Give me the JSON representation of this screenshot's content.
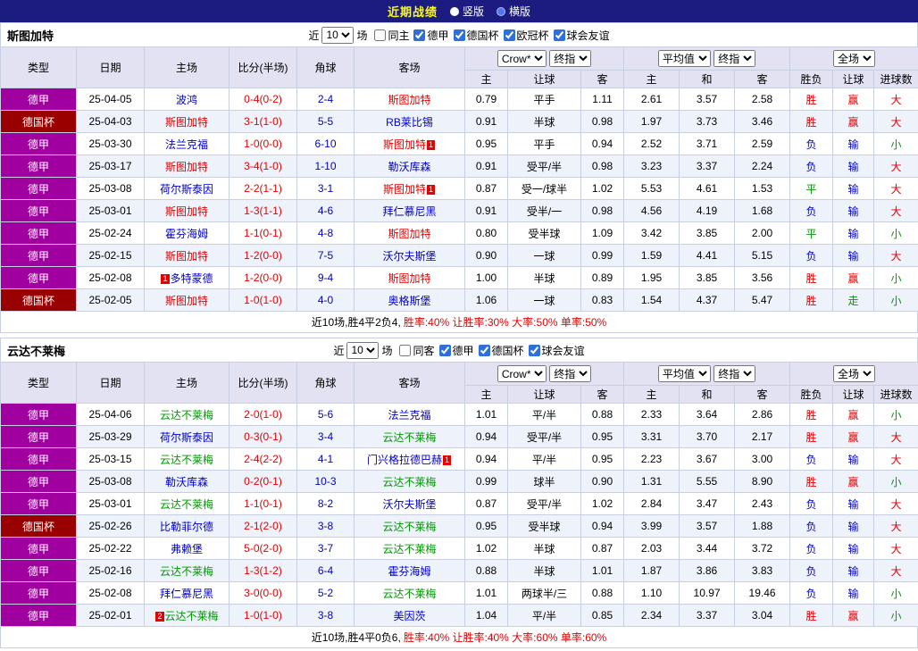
{
  "topbar": {
    "title": "近期战绩",
    "radios": [
      {
        "label": "竖版",
        "checked": true
      },
      {
        "label": "横版",
        "checked": false
      }
    ]
  },
  "columns": {
    "type": "类型",
    "date": "日期",
    "home": "主场",
    "score": "比分(半场)",
    "corner": "角球",
    "away": "客场",
    "h": "主",
    "handicap": "让球",
    "a": "客",
    "draw": "和",
    "result": "胜负",
    "goals": "进球数"
  },
  "selects": {
    "company": "Crow*",
    "final": "终指",
    "average": "平均值",
    "fulltime": "全场"
  },
  "league_colors": {
    "德甲": "#a000a0",
    "德国杯": "#990000"
  },
  "opponent_color": "#0000cc",
  "value_colors": {
    "胜": "#e60000",
    "负": "#0000cc",
    "平": "#009900",
    "赢": "#e60000",
    "输": "#0000cc",
    "走": "#009900",
    "大": "#e60000",
    "小": "#009900"
  },
  "tables": [
    {
      "team": "斯图加特",
      "team_color": "#e60000",
      "filter": {
        "near": "近",
        "count": "10",
        "games": "场",
        "checkboxes": [
          {
            "label": "同主",
            "checked": false
          },
          {
            "label": "德甲",
            "checked": true
          },
          {
            "label": "德国杯",
            "checked": true
          },
          {
            "label": "欧冠杯",
            "checked": true
          },
          {
            "label": "球会友谊",
            "checked": true
          }
        ]
      },
      "rows": [
        {
          "lg": "德甲",
          "dt": "25-04-05",
          "h": "波鸿",
          "hc": "",
          "s": "0-4(0-2)",
          "cn": "2-4",
          "a": "斯图加特",
          "ac": "",
          "o1": "0.79",
          "hd": "平手",
          "o2": "1.11",
          "m1": "2.61",
          "m2": "3.57",
          "m3": "2.58",
          "r1": "胜",
          "r2": "赢",
          "r3": "大"
        },
        {
          "lg": "德国杯",
          "dt": "25-04-03",
          "h": "斯图加特",
          "hc": "",
          "s": "3-1(1-0)",
          "cn": "5-5",
          "a": "RB莱比锡",
          "ac": "",
          "o1": "0.91",
          "hd": "半球",
          "o2": "0.98",
          "m1": "1.97",
          "m2": "3.73",
          "m3": "3.46",
          "r1": "胜",
          "r2": "赢",
          "r3": "大"
        },
        {
          "lg": "德甲",
          "dt": "25-03-30",
          "h": "法兰克福",
          "hc": "",
          "s": "1-0(0-0)",
          "cn": "6-10",
          "a": "斯图加特",
          "ac": "1",
          "o1": "0.95",
          "hd": "平手",
          "o2": "0.94",
          "m1": "2.52",
          "m2": "3.71",
          "m3": "2.59",
          "r1": "负",
          "r2": "输",
          "r3": "小"
        },
        {
          "lg": "德甲",
          "dt": "25-03-17",
          "h": "斯图加特",
          "hc": "",
          "s": "3-4(1-0)",
          "cn": "1-10",
          "a": "勒沃库森",
          "ac": "",
          "o1": "0.91",
          "hd": "受平/半",
          "o2": "0.98",
          "m1": "3.23",
          "m2": "3.37",
          "m3": "2.24",
          "r1": "负",
          "r2": "输",
          "r3": "大"
        },
        {
          "lg": "德甲",
          "dt": "25-03-08",
          "h": "荷尔斯泰因",
          "hc": "",
          "s": "2-2(1-1)",
          "cn": "3-1",
          "a": "斯图加特",
          "ac": "1",
          "o1": "0.87",
          "hd": "受一/球半",
          "o2": "1.02",
          "m1": "5.53",
          "m2": "4.61",
          "m3": "1.53",
          "r1": "平",
          "r2": "输",
          "r3": "大"
        },
        {
          "lg": "德甲",
          "dt": "25-03-01",
          "h": "斯图加特",
          "hc": "",
          "s": "1-3(1-1)",
          "cn": "4-6",
          "a": "拜仁慕尼黑",
          "ac": "",
          "o1": "0.91",
          "hd": "受半/一",
          "o2": "0.98",
          "m1": "4.56",
          "m2": "4.19",
          "m3": "1.68",
          "r1": "负",
          "r2": "输",
          "r3": "大"
        },
        {
          "lg": "德甲",
          "dt": "25-02-24",
          "h": "霍芬海姆",
          "hc": "",
          "s": "1-1(0-1)",
          "cn": "4-8",
          "a": "斯图加特",
          "ac": "",
          "o1": "0.80",
          "hd": "受半球",
          "o2": "1.09",
          "m1": "3.42",
          "m2": "3.85",
          "m3": "2.00",
          "r1": "平",
          "r2": "输",
          "r3": "小"
        },
        {
          "lg": "德甲",
          "dt": "25-02-15",
          "h": "斯图加特",
          "hc": "",
          "s": "1-2(0-0)",
          "cn": "7-5",
          "a": "沃尔夫斯堡",
          "ac": "",
          "o1": "0.90",
          "hd": "一球",
          "o2": "0.99",
          "m1": "1.59",
          "m2": "4.41",
          "m3": "5.15",
          "r1": "负",
          "r2": "输",
          "r3": "大"
        },
        {
          "lg": "德甲",
          "dt": "25-02-08",
          "h": "多特蒙德",
          "hc": "1",
          "s": "1-2(0-0)",
          "cn": "9-4",
          "a": "斯图加特",
          "ac": "",
          "o1": "1.00",
          "hd": "半球",
          "o2": "0.89",
          "m1": "1.95",
          "m2": "3.85",
          "m3": "3.56",
          "r1": "胜",
          "r2": "赢",
          "r3": "小"
        },
        {
          "lg": "德国杯",
          "dt": "25-02-05",
          "h": "斯图加特",
          "hc": "",
          "s": "1-0(1-0)",
          "cn": "4-0",
          "a": "奥格斯堡",
          "ac": "",
          "o1": "1.06",
          "hd": "一球",
          "o2": "0.83",
          "m1": "1.54",
          "m2": "4.37",
          "m3": "5.47",
          "r1": "胜",
          "r2": "走",
          "r3": "小"
        }
      ],
      "summary_prefix": "近10场,胜4平2负4,",
      "summary_stats": "胜率:40% 让胜率:30% 大率:50% 单率:50%"
    },
    {
      "team": "云达不莱梅",
      "team_color": "#009900",
      "filter": {
        "near": "近",
        "count": "10",
        "games": "场",
        "checkboxes": [
          {
            "label": "同客",
            "checked": false
          },
          {
            "label": "德甲",
            "checked": true
          },
          {
            "label": "德国杯",
            "checked": true
          },
          {
            "label": "球会友谊",
            "checked": true
          }
        ]
      },
      "rows": [
        {
          "lg": "德甲",
          "dt": "25-04-06",
          "h": "云达不莱梅",
          "hc": "",
          "s": "2-0(1-0)",
          "cn": "5-6",
          "a": "法兰克福",
          "ac": "",
          "o1": "1.01",
          "hd": "平/半",
          "o2": "0.88",
          "m1": "2.33",
          "m2": "3.64",
          "m3": "2.86",
          "r1": "胜",
          "r2": "赢",
          "r3": "小"
        },
        {
          "lg": "德甲",
          "dt": "25-03-29",
          "h": "荷尔斯泰因",
          "hc": "",
          "s": "0-3(0-1)",
          "cn": "3-4",
          "a": "云达不莱梅",
          "ac": "",
          "o1": "0.94",
          "hd": "受平/半",
          "o2": "0.95",
          "m1": "3.31",
          "m2": "3.70",
          "m3": "2.17",
          "r1": "胜",
          "r2": "赢",
          "r3": "大"
        },
        {
          "lg": "德甲",
          "dt": "25-03-15",
          "h": "云达不莱梅",
          "hc": "",
          "s": "2-4(2-2)",
          "cn": "4-1",
          "a": "门兴格拉德巴赫",
          "ac": "1",
          "o1": "0.94",
          "hd": "平/半",
          "o2": "0.95",
          "m1": "2.23",
          "m2": "3.67",
          "m3": "3.00",
          "r1": "负",
          "r2": "输",
          "r3": "大"
        },
        {
          "lg": "德甲",
          "dt": "25-03-08",
          "h": "勒沃库森",
          "hc": "",
          "s": "0-2(0-1)",
          "cn": "10-3",
          "a": "云达不莱梅",
          "ac": "",
          "o1": "0.99",
          "hd": "球半",
          "o2": "0.90",
          "m1": "1.31",
          "m2": "5.55",
          "m3": "8.90",
          "r1": "胜",
          "r2": "赢",
          "r3": "小"
        },
        {
          "lg": "德甲",
          "dt": "25-03-01",
          "h": "云达不莱梅",
          "hc": "",
          "s": "1-1(0-1)",
          "cn": "8-2",
          "a": "沃尔夫斯堡",
          "ac": "",
          "o1": "0.87",
          "hd": "受平/半",
          "o2": "1.02",
          "m1": "2.84",
          "m2": "3.47",
          "m3": "2.43",
          "r1": "负",
          "r2": "输",
          "r3": "大"
        },
        {
          "lg": "德国杯",
          "dt": "25-02-26",
          "h": "比勒菲尔德",
          "hc": "",
          "s": "2-1(2-0)",
          "cn": "3-8",
          "a": "云达不莱梅",
          "ac": "",
          "o1": "0.95",
          "hd": "受半球",
          "o2": "0.94",
          "m1": "3.99",
          "m2": "3.57",
          "m3": "1.88",
          "r1": "负",
          "r2": "输",
          "r3": "大"
        },
        {
          "lg": "德甲",
          "dt": "25-02-22",
          "h": "弗赖堡",
          "hc": "",
          "s": "5-0(2-0)",
          "cn": "3-7",
          "a": "云达不莱梅",
          "ac": "",
          "o1": "1.02",
          "hd": "半球",
          "o2": "0.87",
          "m1": "2.03",
          "m2": "3.44",
          "m3": "3.72",
          "r1": "负",
          "r2": "输",
          "r3": "大"
        },
        {
          "lg": "德甲",
          "dt": "25-02-16",
          "h": "云达不莱梅",
          "hc": "",
          "s": "1-3(1-2)",
          "cn": "6-4",
          "a": "霍芬海姆",
          "ac": "",
          "o1": "0.88",
          "hd": "半球",
          "o2": "1.01",
          "m1": "1.87",
          "m2": "3.86",
          "m3": "3.83",
          "r1": "负",
          "r2": "输",
          "r3": "大"
        },
        {
          "lg": "德甲",
          "dt": "25-02-08",
          "h": "拜仁慕尼黑",
          "hc": "",
          "s": "3-0(0-0)",
          "cn": "5-2",
          "a": "云达不莱梅",
          "ac": "",
          "o1": "1.01",
          "hd": "两球半/三",
          "o2": "0.88",
          "m1": "1.10",
          "m2": "10.97",
          "m3": "19.46",
          "r1": "负",
          "r2": "输",
          "r3": "小"
        },
        {
          "lg": "德甲",
          "dt": "25-02-01",
          "h": "云达不莱梅",
          "hc": "2",
          "s": "1-0(1-0)",
          "cn": "3-8",
          "a": "美因茨",
          "ac": "",
          "o1": "1.04",
          "hd": "平/半",
          "o2": "0.85",
          "m1": "2.34",
          "m2": "3.37",
          "m3": "3.04",
          "r1": "胜",
          "r2": "赢",
          "r3": "小"
        }
      ],
      "summary_prefix": "近10场,胜4平0负6,",
      "summary_stats": "胜率:40% 让胜率:40% 大率:60% 单率:60%"
    }
  ]
}
